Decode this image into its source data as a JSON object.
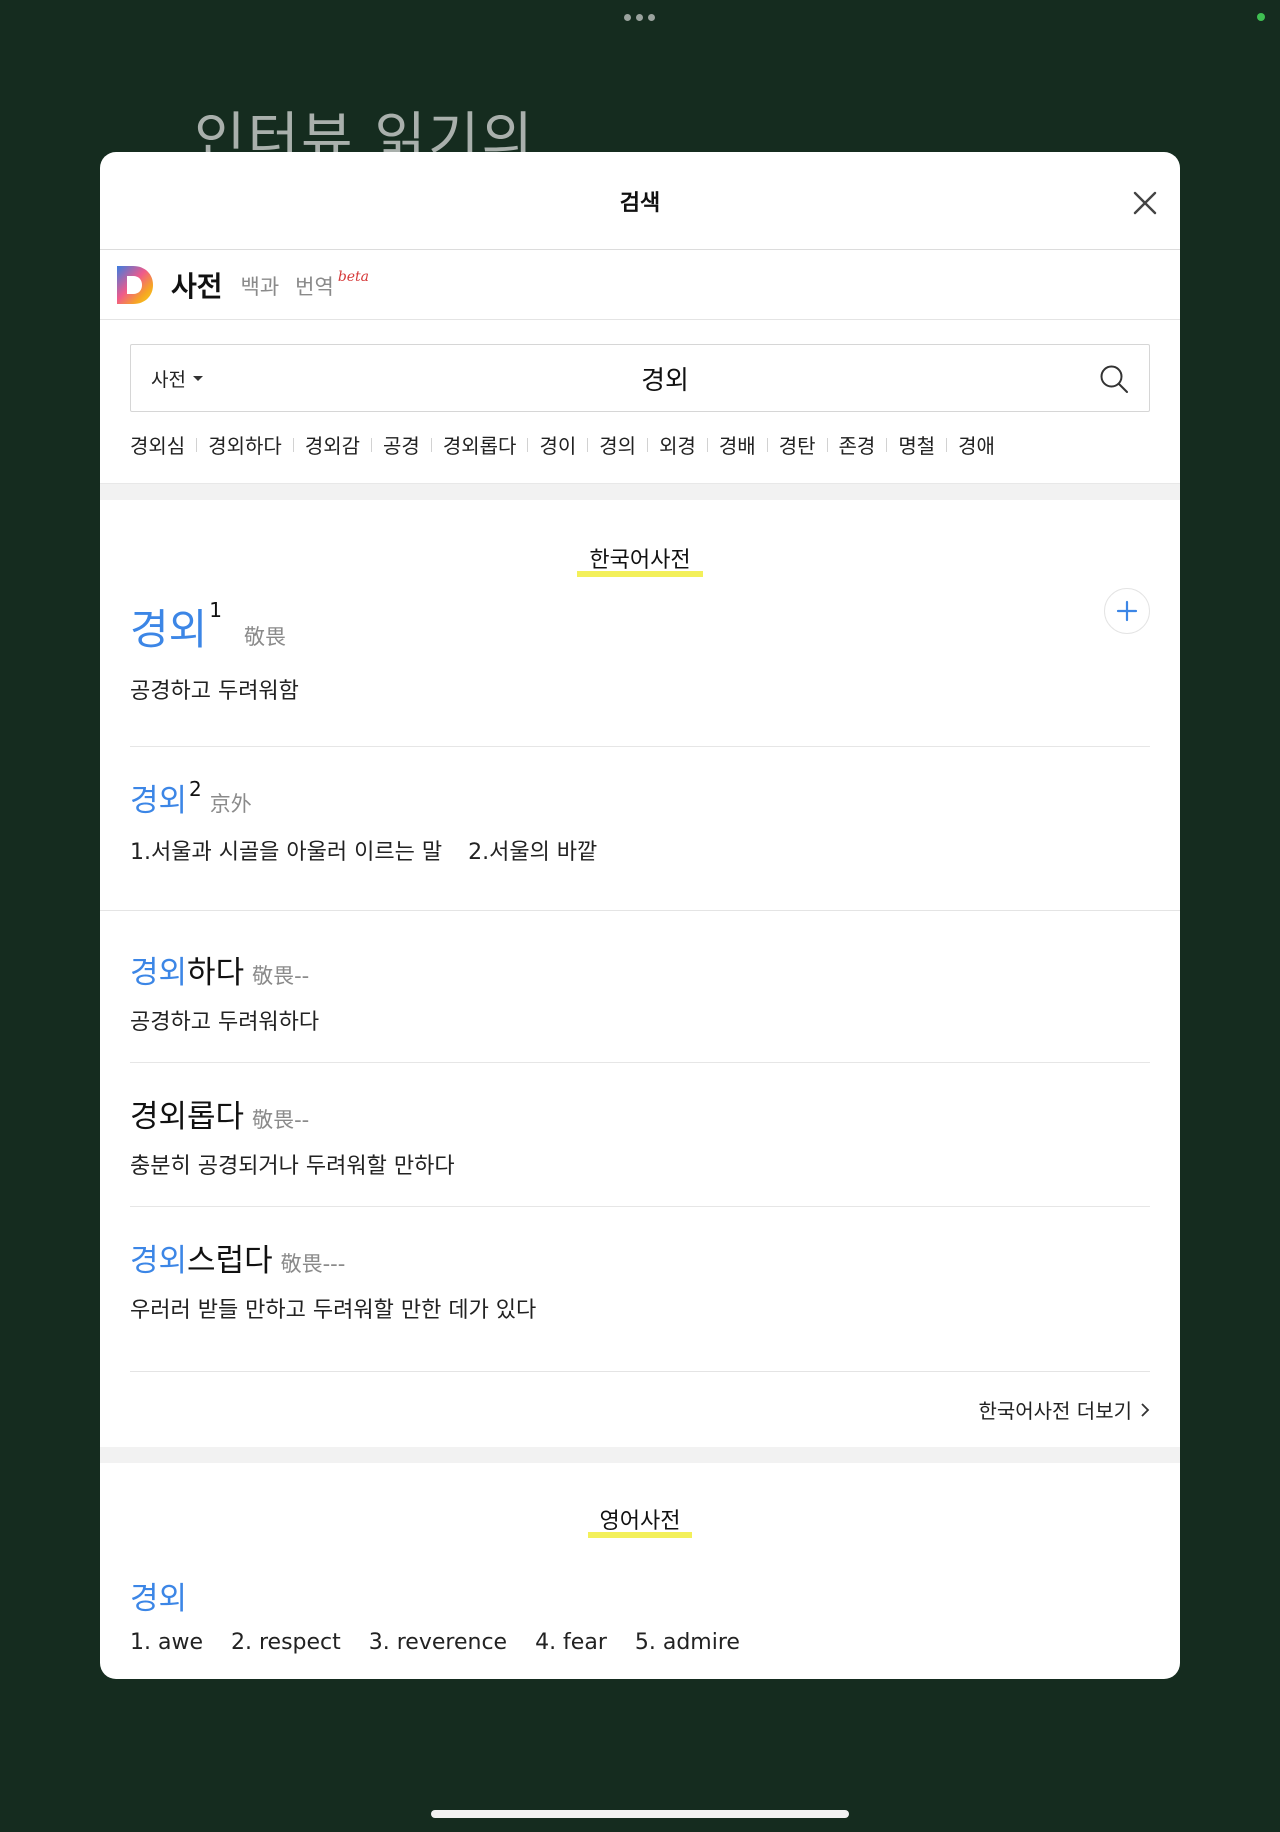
{
  "background": {
    "title": "인터뷰 읽기의"
  },
  "modal": {
    "title": "검색",
    "close_icon": "close-icon"
  },
  "service": {
    "active_tab": "사전",
    "tabs": [
      "백과",
      "번역"
    ],
    "beta_label": "beta"
  },
  "search": {
    "scope": "사전",
    "query": "경외"
  },
  "suggestions": [
    "경외심",
    "경외하다",
    "경외감",
    "공경",
    "경외롭다",
    "경이",
    "경의",
    "외경",
    "경배",
    "경탄",
    "존경",
    "명철",
    "경애"
  ],
  "korean_dict": {
    "section_title": "한국어사전",
    "entries": [
      {
        "highlight": "경외",
        "rest": "",
        "sup": "1",
        "hanja": "敬畏",
        "meaning": "공경하고 두려워함"
      },
      {
        "highlight": "경외",
        "rest": "",
        "sup": "2",
        "hanja": "京外",
        "meaning_1": "1.서울과 시골을 아울러 이르는 말",
        "meaning_2": "2.서울의 바깥"
      },
      {
        "highlight": "경외",
        "rest": "하다",
        "hanja": "敬畏--",
        "meaning": "공경하고 두려워하다"
      },
      {
        "highlight": "",
        "rest": "경외롭다",
        "hanja": "敬畏--",
        "meaning": "충분히 공경되거나 두려워할 만하다"
      },
      {
        "highlight": "경외",
        "rest": "스럽다",
        "hanja": "敬畏---",
        "meaning": "우러러 받들 만하고 두려워할 만한 데가 있다"
      }
    ],
    "more_label": "한국어사전 더보기"
  },
  "english_dict": {
    "section_title": "영어사전",
    "word": "경외",
    "meanings": [
      "1. awe",
      "2. respect",
      "3. reverence",
      "4. fear",
      "5. admire"
    ]
  },
  "colors": {
    "accent": "#3c86e6",
    "highlight": "#f3f05a",
    "background": "#152c1f"
  }
}
